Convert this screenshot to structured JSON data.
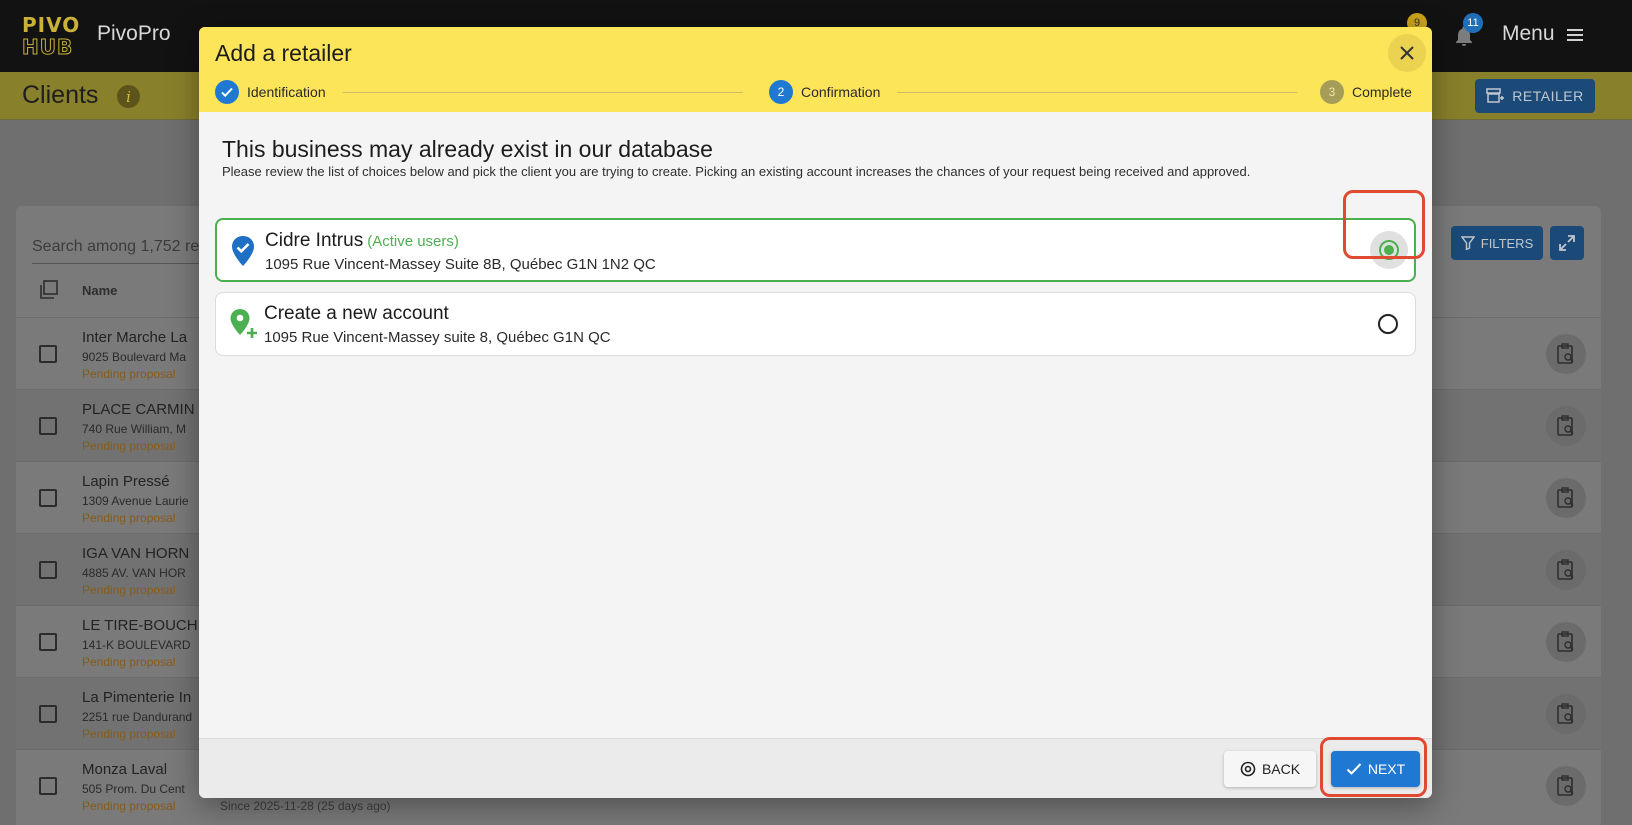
{
  "app": {
    "logo_text": "PIVO HUB",
    "name": "PivoPro",
    "badges": {
      "cart": "9",
      "notifications": "11"
    },
    "menu_label": "Menu"
  },
  "page": {
    "title": "Clients",
    "info_icon": "i",
    "retailer_button": "RETAILER",
    "search_placeholder": "Search among 1,752 re",
    "filters_button": "FILTERS",
    "column_name": "Name",
    "rows": [
      {
        "name": "Inter Marche La",
        "address": "9025 Boulevard Ma",
        "status": "Pending proposal",
        "since": ""
      },
      {
        "name": "PLACE CARMIN",
        "address": "740 Rue William, M",
        "status": "Pending proposal",
        "since": ""
      },
      {
        "name": "Lapin Pressé",
        "address": "1309 Avenue Laurie",
        "status": "Pending proposal",
        "since": ""
      },
      {
        "name": "IGA VAN HORN",
        "address": "4885 AV. VAN HOR",
        "status": "Pending proposal",
        "since": ""
      },
      {
        "name": "LE TIRE-BOUCH",
        "address": "141-K BOULEVARD",
        "status": "Pending proposal",
        "since": ""
      },
      {
        "name": "La Pimenterie In",
        "address": "2251 rue Dandurand",
        "status": "Pending proposal",
        "since": ""
      },
      {
        "name": "Monza Laval",
        "address": "505 Prom. Du Cent",
        "status": "Pending proposal",
        "since": "Since 2025-11-28 (25 days ago)"
      }
    ]
  },
  "modal": {
    "title": "Add a retailer",
    "steps": [
      {
        "label": "Identification",
        "state": "done",
        "number": "1"
      },
      {
        "label": "Confirmation",
        "state": "active",
        "number": "2"
      },
      {
        "label": "Complete",
        "state": "pending",
        "number": "3"
      }
    ],
    "heading": "This business may already exist in our database",
    "subtext": "Please review the list of choices below and pick the client you are trying to create. Picking an existing account increases the chances of your request being received and approved.",
    "options": [
      {
        "title": "Cidre Intrus",
        "tag": "(Active users)",
        "address": "1095 Rue Vincent-Massey Suite 8B, Québec G1N 1N2 QC",
        "icon": "verified-location-icon",
        "selected": true
      },
      {
        "title": "Create a new account",
        "tag": "",
        "address": "1095 Rue Vincent-Massey suite 8, Québec G1N QC",
        "icon": "add-location-icon",
        "selected": false
      }
    ],
    "back_button": "BACK",
    "next_button": "NEXT"
  },
  "colors": {
    "header_yellow": "#fde55a",
    "primary_blue": "#1f78d1",
    "selected_green": "#4caf50",
    "highlight_red": "#e04a32"
  }
}
